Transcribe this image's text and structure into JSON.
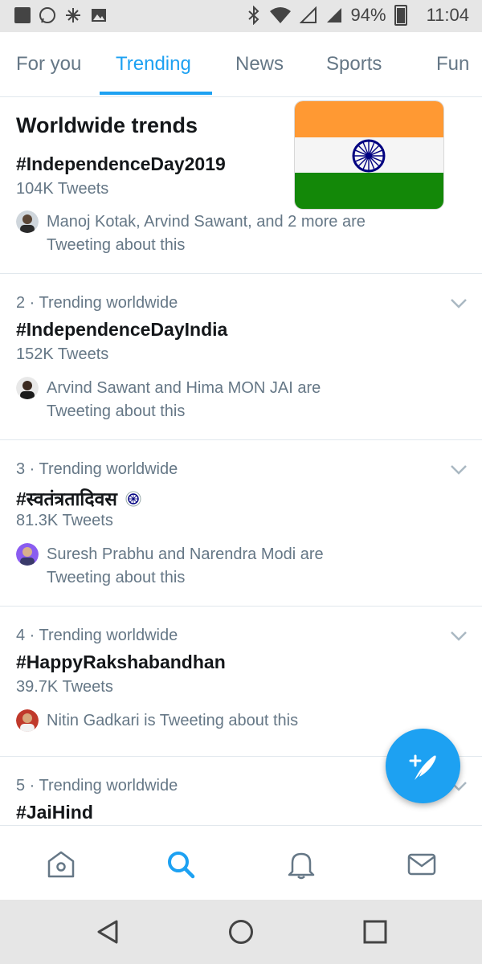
{
  "status_bar": {
    "battery": "94%",
    "time": "11:04"
  },
  "tabs": [
    {
      "label": "For you",
      "active": false
    },
    {
      "label": "Trending",
      "active": true
    },
    {
      "label": "News",
      "active": false
    },
    {
      "label": "Sports",
      "active": false
    },
    {
      "label": "Fun",
      "active": false
    }
  ],
  "list": {
    "header": "Worldwide trends",
    "trends": [
      {
        "meta": "",
        "hashtag": "#IndependenceDay2019",
        "count": "104K Tweets",
        "who_line1": "Manoj Kotak, Arvind Sawant, and 2 more are",
        "who_line2": "Tweeting about this"
      },
      {
        "meta": "2 · Trending worldwide",
        "hashtag": "#IndependenceDayIndia",
        "count": "152K Tweets",
        "who_line1": "Arvind Sawant and Hima MON JAI are",
        "who_line2": "Tweeting about this"
      },
      {
        "meta": "3 · Trending worldwide",
        "hashtag": "#स्वतंत्रतादिवस",
        "count": "81.3K Tweets",
        "who_line1": "Suresh Prabhu and Narendra Modi are",
        "who_line2": "Tweeting about this"
      },
      {
        "meta": "4 · Trending worldwide",
        "hashtag": "#HappyRakshabandhan",
        "count": "39.7K Tweets",
        "who_line1": "Nitin Gadkari is Tweeting about this",
        "who_line2": ""
      },
      {
        "meta": "5 · Trending worldwide",
        "hashtag": "#JaiHind",
        "count": "",
        "who_line1": "",
        "who_line2": ""
      }
    ]
  },
  "colors": {
    "accent": "#1da1f2",
    "saffron": "#ff9933",
    "india_green": "#138808",
    "chakra_blue": "#000080"
  }
}
